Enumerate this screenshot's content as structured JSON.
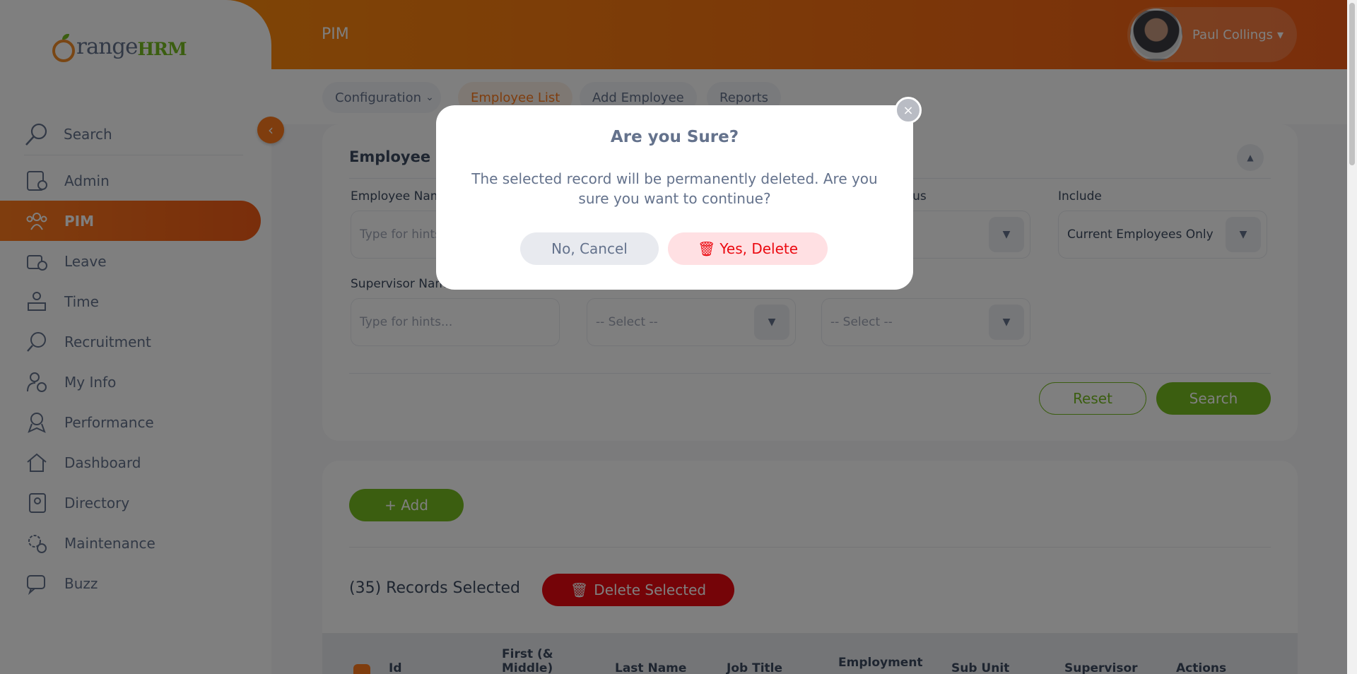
{
  "app": {
    "brand_main": "range",
    "brand_suffix": "HRM",
    "page_title": "PIM"
  },
  "user": {
    "name": "Paul Collings",
    "caret": "▾"
  },
  "sidebar": {
    "search_label": "Search",
    "collapse_glyph": "‹",
    "items": [
      {
        "label": "Admin",
        "icon": "admin-icon"
      },
      {
        "label": "PIM",
        "icon": "pim-icon",
        "active": true
      },
      {
        "label": "Leave",
        "icon": "leave-icon"
      },
      {
        "label": "Time",
        "icon": "time-icon"
      },
      {
        "label": "Recruitment",
        "icon": "recruitment-icon"
      },
      {
        "label": "My Info",
        "icon": "my-info-icon"
      },
      {
        "label": "Performance",
        "icon": "performance-icon"
      },
      {
        "label": "Dashboard",
        "icon": "dashboard-icon"
      },
      {
        "label": "Directory",
        "icon": "directory-icon"
      },
      {
        "label": "Maintenance",
        "icon": "maintenance-icon"
      },
      {
        "label": "Buzz",
        "icon": "buzz-icon"
      }
    ]
  },
  "tabs": {
    "configuration": "Configuration",
    "employee_list": "Employee List",
    "add_employee": "Add Employee",
    "reports": "Reports"
  },
  "filter": {
    "title": "Employee Inf",
    "employee_name_label": "Employee Nam",
    "employee_name_placeholder": "Type for hints",
    "status_label": "atus",
    "include_label": "Include",
    "include_value": "Current Employees Only",
    "supervisor_label": "Supervisor Nam",
    "supervisor_placeholder": "Type for hints...",
    "select_placeholder": "-- Select --",
    "reset": "Reset",
    "search": "Search"
  },
  "records": {
    "add": "+ Add",
    "selected": "(35) Records Selected",
    "delete_selected": "Delete Selected",
    "columns": [
      "Id",
      "First (& Middle)",
      "Last Name",
      "Job Title",
      "Employment",
      "Sub Unit",
      "Supervisor",
      "Actions"
    ]
  },
  "modal": {
    "title": "Are you Sure?",
    "message": "The selected record will be permanently deleted. Are you sure you want to continue?",
    "cancel": "No, Cancel",
    "confirm": "Yes, Delete",
    "close_glyph": "×"
  },
  "colors": {
    "accent": "#ff7b1d",
    "green": "#76bc21",
    "danger": "#eb0910"
  }
}
